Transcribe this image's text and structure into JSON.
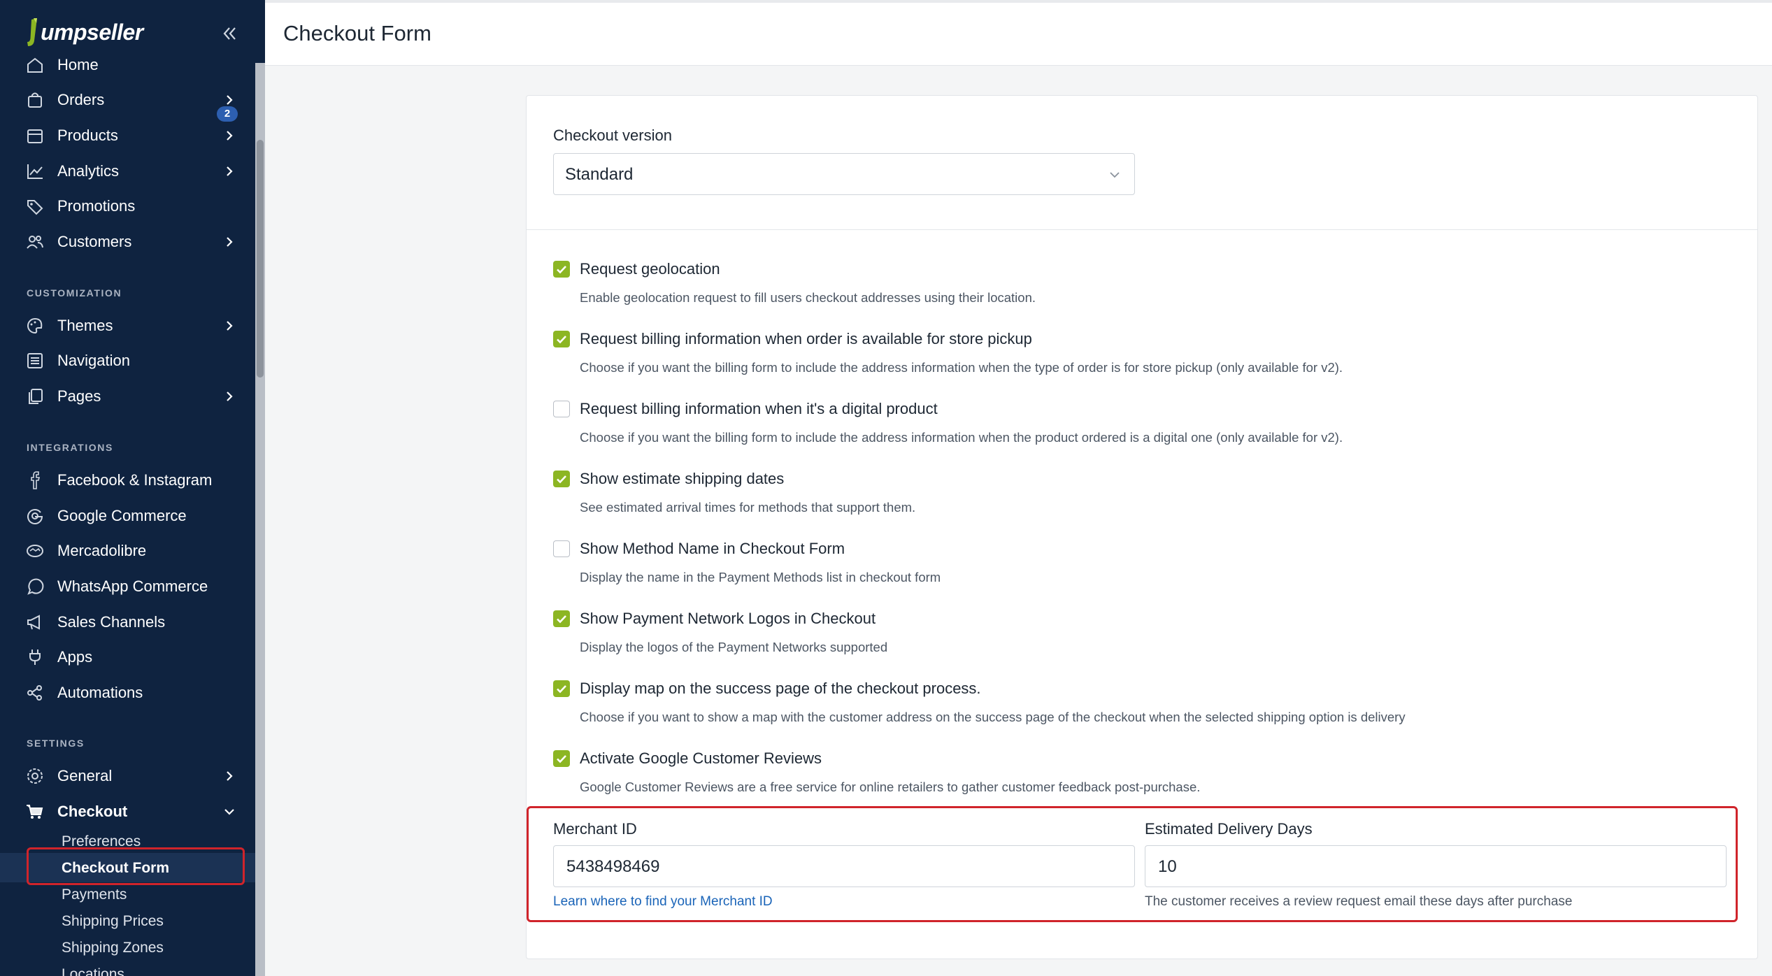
{
  "app": {
    "logo_text": "umpseller"
  },
  "sidebar": {
    "home_badge": "2",
    "items": [
      {
        "label": "Home"
      },
      {
        "label": "Orders"
      },
      {
        "label": "Products"
      },
      {
        "label": "Analytics"
      },
      {
        "label": "Promotions"
      },
      {
        "label": "Customers"
      }
    ],
    "customization_header": "CUSTOMIZATION",
    "customization": [
      {
        "label": "Themes"
      },
      {
        "label": "Navigation"
      },
      {
        "label": "Pages"
      }
    ],
    "integrations_header": "INTEGRATIONS",
    "integrations": [
      {
        "label": "Facebook & Instagram"
      },
      {
        "label": "Google Commerce"
      },
      {
        "label": "Mercadolibre"
      },
      {
        "label": "WhatsApp Commerce"
      },
      {
        "label": "Sales Channels"
      },
      {
        "label": "Apps"
      },
      {
        "label": "Automations"
      }
    ],
    "settings_header": "SETTINGS",
    "settings": [
      {
        "label": "General"
      },
      {
        "label": "Checkout"
      }
    ],
    "checkout_sub": [
      {
        "label": "Preferences"
      },
      {
        "label": "Checkout Form"
      },
      {
        "label": "Payments"
      },
      {
        "label": "Shipping Prices"
      },
      {
        "label": "Shipping Zones"
      },
      {
        "label": "Locations"
      }
    ]
  },
  "header": {
    "title": "Checkout Form"
  },
  "form": {
    "checkout_version_label": "Checkout version",
    "checkout_version_value": "Standard",
    "options": [
      {
        "title": "Request geolocation",
        "desc": "Enable geolocation request to fill users checkout addresses using their location.",
        "checked": true
      },
      {
        "title": "Request billing information when order is available for store pickup",
        "desc": "Choose if you want the billing form to include the address information when the type of order is for store pickup (only available for v2).",
        "checked": true
      },
      {
        "title": "Request billing information when it's a digital product",
        "desc": "Choose if you want the billing form to include the address information when the product ordered is a digital one (only available for v2).",
        "checked": false
      },
      {
        "title": "Show estimate shipping dates",
        "desc": "See estimated arrival times for methods that support them.",
        "checked": true
      },
      {
        "title": "Show Method Name in Checkout Form",
        "desc": "Display the name in the Payment Methods list in checkout form",
        "checked": false
      },
      {
        "title": "Show Payment Network Logos in Checkout",
        "desc": "Display the logos of the Payment Networks supported",
        "checked": true
      },
      {
        "title": "Display map on the success page of the checkout process.",
        "desc": "Choose if you want to show a map with the customer address on the success page of the checkout when the selected shipping option is delivery",
        "checked": true
      },
      {
        "title": "Activate Google Customer Reviews",
        "desc": "Google Customer Reviews are a free service for online retailers to gather customer feedback post-purchase.",
        "checked": true
      }
    ],
    "merchant_id_label": "Merchant ID",
    "merchant_id_value": "5438498469",
    "merchant_id_link": "Learn where to find your Merchant ID",
    "delivery_days_label": "Estimated Delivery Days",
    "delivery_days_value": "10",
    "delivery_days_hint": "The customer receives a review request email these days after purchase"
  },
  "colors": {
    "sidebar_bg": "#0f2340",
    "accent_green": "#8cb623",
    "highlight_red": "#d0242b",
    "link_blue": "#1a64b8"
  }
}
